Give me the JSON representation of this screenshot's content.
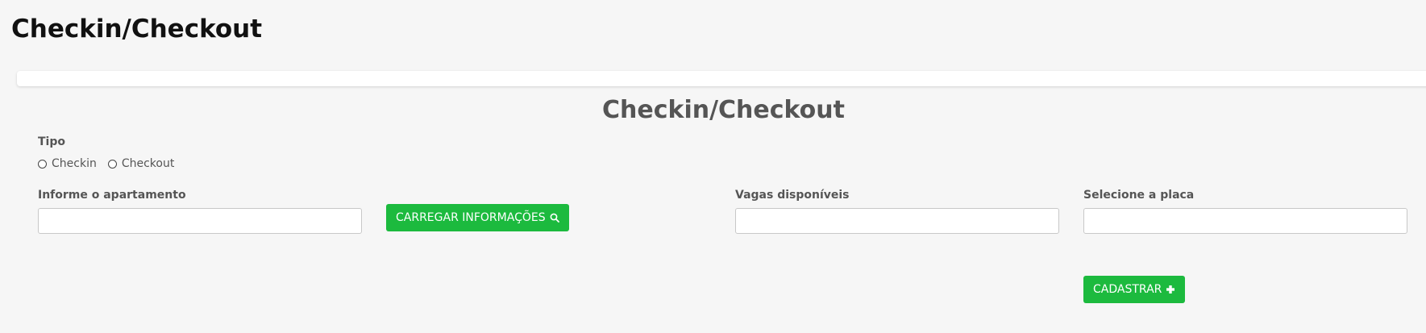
{
  "page": {
    "title": "Checkin/Checkout"
  },
  "form": {
    "title": "Checkin/Checkout",
    "tipo": {
      "label": "Tipo",
      "options": [
        "Checkin",
        "Checkout"
      ]
    },
    "apartamento": {
      "label": "Informe o apartamento",
      "value": "",
      "placeholder": ""
    },
    "carregar_button": {
      "label": "CARREGAR INFORMAÇÕES",
      "icon": "search-icon"
    },
    "vagas": {
      "label": "Vagas disponíveis",
      "value": "",
      "placeholder": ""
    },
    "placa": {
      "label": "Selecione a placa",
      "value": "",
      "placeholder": ""
    },
    "cadastrar_button": {
      "label": "CADASTRAR",
      "icon": "plus-icon"
    }
  },
  "colors": {
    "accent": "#1cba3e",
    "background": "#f6f6f6",
    "label": "#555555"
  }
}
